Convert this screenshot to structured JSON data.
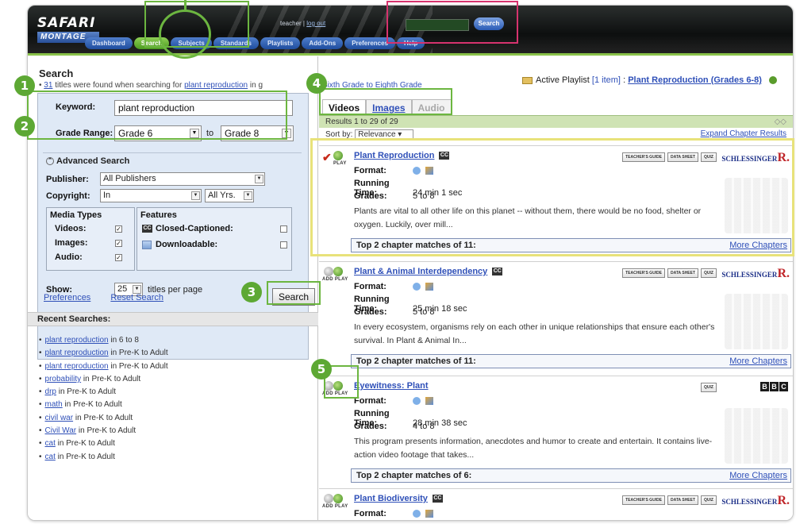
{
  "header": {
    "logo_top": "SAFARI",
    "logo_bottom": "MONTAGE",
    "user": "teacher",
    "separator": "|",
    "logout": "log out",
    "search_button": "Search",
    "nav": [
      "Dashboard",
      "Search",
      "Subjects",
      "Standards",
      "Playlists",
      "Add-Ons",
      "Preferences",
      "Help"
    ],
    "active_nav": "Search"
  },
  "left": {
    "title": "Search",
    "summary_count": "31",
    "summary_text": "titles were found when searching for",
    "summary_query": "plant reproduction",
    "summary_tail": "in g",
    "keyword_label": "Keyword:",
    "keyword_value": "plant reproduction",
    "grade_label": "Grade Range:",
    "grade_from": "Grade 6",
    "grade_to_label": "to",
    "grade_to": "Grade 8",
    "advanced_title": "Advanced Search",
    "publisher_label": "Publisher:",
    "publisher_value": "All Publishers",
    "copyright_label": "Copyright:",
    "copyright_value": "In",
    "copyright_years": "All Yrs.",
    "media_types_label": "Media Types",
    "media_videos": "Videos:",
    "media_images": "Images:",
    "media_audio": "Audio:",
    "features_label": "Features",
    "feature_cc": "Closed-Captioned:",
    "feature_dl": "Downloadable:",
    "show_label": "Show:",
    "show_value": "25",
    "show_suffix": "titles per page",
    "preferences_link": "Preferences",
    "reset_link": "Reset Search",
    "search_button": "Search",
    "recent_title": "Recent Searches:",
    "recent": [
      {
        "term": "plant reproduction",
        "range": "in 6 to 8"
      },
      {
        "term": "plant reproduction",
        "range": "in Pre-K to Adult"
      },
      {
        "term": "plant reproduction",
        "range": "in Pre-K to Adult"
      },
      {
        "term": "probability",
        "range": "in Pre-K to Adult"
      },
      {
        "term": "drp",
        "range": "in Pre-K to Adult"
      },
      {
        "term": "math",
        "range": "in Pre-K to Adult"
      },
      {
        "term": "civil war",
        "range": "in Pre-K to Adult"
      },
      {
        "term": "Civil War",
        "range": "in Pre-K to Adult"
      },
      {
        "term": "cat",
        "range": "in Pre-K to Adult"
      },
      {
        "term": "cat",
        "range": "in Pre-K to Adult"
      }
    ]
  },
  "right": {
    "grade_line": "Sixth Grade to Eighth Grade",
    "playlist_label": "Active Playlist",
    "playlist_count": "[1 item]",
    "playlist_sep": ":",
    "playlist_name": "Plant Reproduction (Grades 6-8)",
    "tabs": [
      "Videos",
      "Images",
      "Audio"
    ],
    "results_text": "Results 1 to 29 of 29",
    "sort_label": "Sort by:",
    "sort_value": "Relevance",
    "expand_link": "Expand Chapter Results",
    "field_format": "Format:",
    "field_running": "Running Time:",
    "field_grades": "Grades:",
    "more_chapters": "More Chapters",
    "play_label": "PLAY",
    "add_play_label": "ADD PLAY",
    "badge_guide": "TEACHER'S GUIDE",
    "badge_sheet": "DATA SHEET",
    "badge_quiz": "QUIZ",
    "publisher_schlessinger": "SCHLESSINGER",
    "publisher_r": "R.",
    "bbc": [
      "B",
      "B",
      "C"
    ],
    "results": [
      {
        "title": "Plant Reproduction",
        "running": "24 min 1 sec",
        "grades": "5 to 8",
        "desc": "Plants are vital to all other life on this planet -- without them, there would be no food, shelter or oxygen. Luckily, over mill...",
        "chapters": "Top 2 chapter matches of 11:"
      },
      {
        "title": "Plant & Animal Interdependency",
        "running": "25 min 18 sec",
        "grades": "5 to 8",
        "desc": "In every ecosystem, organisms rely on each other in unique relationships that ensure each other's survival. In Plant & Animal In...",
        "chapters": "Top 2 chapter matches of 11:"
      },
      {
        "title": "Eyewitness: Plant",
        "running": "28 min 38 sec",
        "grades": "4 to 8",
        "desc": "This program presents information, anecdotes and humor to create and entertain. It contains live-action video footage that takes...",
        "chapters": "Top 2 chapter matches of 6:"
      },
      {
        "title": "Plant Biodiversity"
      }
    ]
  },
  "annotations": [
    "1",
    "2",
    "3",
    "4",
    "5"
  ],
  "colors": {
    "annotation_green": "#5da834",
    "highlight_yellow": "#e8e27a",
    "highlight_pink": "#d6336e",
    "link_blue": "#2f50b8"
  }
}
